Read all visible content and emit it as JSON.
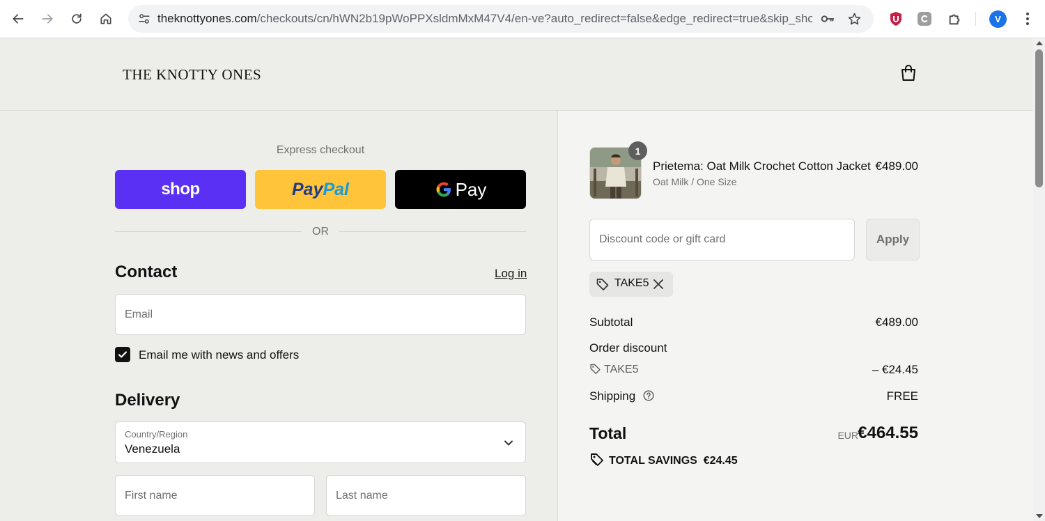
{
  "browser": {
    "url_domain": "theknottyones.com",
    "url_path": "/checkouts/cn/hWN2b19pWoPPXsldmMxM47V4/en-ve?auto_redirect=false&edge_redirect=true&skip_shop...",
    "profile_initial": "V"
  },
  "store": {
    "logo": "THE KNOTTY ONES"
  },
  "express": {
    "title": "Express checkout",
    "shop_label": "shop",
    "paypal_label_1": "Pay",
    "paypal_label_2": "Pal",
    "gpay_g": "G",
    "gpay_label": "Pay",
    "or_label": "OR"
  },
  "contact": {
    "title": "Contact",
    "login_label": "Log in",
    "email_placeholder": "Email",
    "newsletter_label": "Email me with news and offers",
    "newsletter_checked": true
  },
  "delivery": {
    "title": "Delivery",
    "country_label": "Country/Region",
    "country_value": "Venezuela",
    "first_name_placeholder": "First name",
    "last_name_placeholder": "Last name"
  },
  "order": {
    "product": {
      "quantity": "1",
      "name": "Prietema: Oat Milk Crochet Cotton Jacket",
      "variant": "Oat Milk / One Size",
      "price": "€489.00"
    },
    "discount_placeholder": "Discount code or gift card",
    "apply_label": "Apply",
    "applied_code": "TAKE5",
    "subtotal_label": "Subtotal",
    "subtotal_value": "€489.00",
    "order_discount_label": "Order discount",
    "discount_code": "TAKE5",
    "discount_value": "– €24.45",
    "shipping_label": "Shipping",
    "shipping_value": "FREE",
    "total_label": "Total",
    "total_currency": "EUR",
    "total_value": "€464.55",
    "savings_label": "TOTAL SAVINGS",
    "savings_value": "€24.45"
  },
  "colors": {
    "shop_purple": "#5a31f4",
    "paypal_yellow": "#ffc43a",
    "gpay_black": "#000000",
    "page_bg_left": "#ededea",
    "page_bg_right": "#f4f4f3"
  }
}
